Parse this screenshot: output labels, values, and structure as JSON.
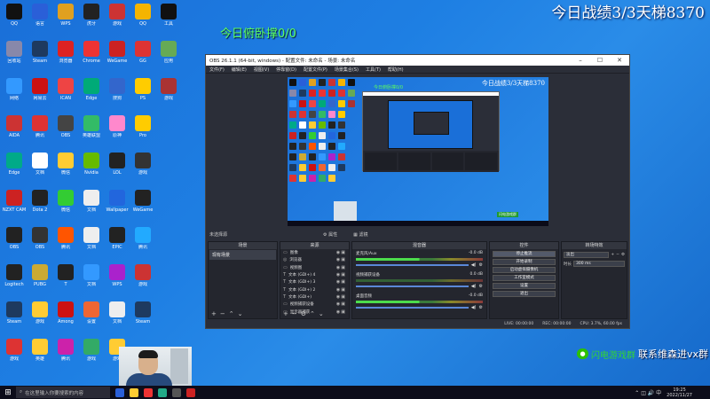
{
  "overlay": {
    "top_right": "今日战绩3/3天梯8370",
    "pushup": "今日俯卧撑0/0",
    "wechat_green": "闪电游戏群",
    "wechat_white": "联系维森进vx群"
  },
  "desktop": {
    "icons": [
      {
        "label": "QQ",
        "color": "#111"
      },
      {
        "label": "语言",
        "color": "#2a5fd8"
      },
      {
        "label": "WPS",
        "color": "#e0a020"
      },
      {
        "label": "虎牙",
        "color": "#222"
      },
      {
        "label": "游戏",
        "color": "#c33"
      },
      {
        "label": "QQ",
        "color": "#f5b400"
      },
      {
        "label": "工具",
        "color": "#111"
      },
      {
        "label": "回收站",
        "color": "#88a"
      },
      {
        "label": "Steam",
        "color": "#1e3a5f"
      },
      {
        "label": "浏览器",
        "color": "#d22"
      },
      {
        "label": "Chrome",
        "color": "#e33"
      },
      {
        "label": "WeGame",
        "color": "#c22"
      },
      {
        "label": "GG",
        "color": "#d33"
      },
      {
        "label": "应用",
        "color": "#6a5"
      },
      {
        "label": "网络",
        "color": "#39f"
      },
      {
        "label": "网易云",
        "color": "#c11"
      },
      {
        "label": "ICAN",
        "color": "#e44"
      },
      {
        "label": "Edge",
        "color": "#0a7"
      },
      {
        "label": "搜狗",
        "color": "#36c"
      },
      {
        "label": "PS",
        "color": "#fc0"
      },
      {
        "label": "游戏",
        "color": "#a33"
      },
      {
        "label": "AIDA",
        "color": "#c33"
      },
      {
        "label": "腾讯",
        "color": "#d33"
      },
      {
        "label": "OBS",
        "color": "#444"
      },
      {
        "label": "英雄联盟",
        "color": "#3b6"
      },
      {
        "label": "原神",
        "color": "#f8c"
      },
      {
        "label": "Pro",
        "color": "#fc0"
      },
      {
        "label": "",
        "color": "transparent"
      },
      {
        "label": "Edge",
        "color": "#0a8"
      },
      {
        "label": "文档",
        "color": "#fff"
      },
      {
        "label": "微信",
        "color": "#fc3"
      },
      {
        "label": "Nvidia",
        "color": "#6b0"
      },
      {
        "label": "LOL",
        "color": "#222"
      },
      {
        "label": "游戏",
        "color": "#333"
      },
      {
        "label": "",
        "color": "transparent"
      },
      {
        "label": "NZXT CAM",
        "color": "#c22"
      },
      {
        "label": "Dota 2",
        "color": "#222"
      },
      {
        "label": "微信",
        "color": "#3c3"
      },
      {
        "label": "文档",
        "color": "#eee"
      },
      {
        "label": "Wallpaper",
        "color": "#26d"
      },
      {
        "label": "WeGame",
        "color": "#222"
      },
      {
        "label": "",
        "color": "transparent"
      },
      {
        "label": "OBS",
        "color": "#222"
      },
      {
        "label": "OBS",
        "color": "#333"
      },
      {
        "label": "腾讯",
        "color": "#f50"
      },
      {
        "label": "文档",
        "color": "#eee"
      },
      {
        "label": "EPIC",
        "color": "#222"
      },
      {
        "label": "腾讯",
        "color": "#2af"
      },
      {
        "label": "",
        "color": "transparent"
      },
      {
        "label": "Logitech",
        "color": "#222"
      },
      {
        "label": "PUBG",
        "color": "#ca3"
      },
      {
        "label": "T",
        "color": "#222"
      },
      {
        "label": "文档",
        "color": "#39f"
      },
      {
        "label": "WPS",
        "color": "#a2c"
      },
      {
        "label": "游戏",
        "color": "#c33"
      },
      {
        "label": "",
        "color": "transparent"
      },
      {
        "label": "Steam",
        "color": "#1e3a5f"
      },
      {
        "label": "游戏",
        "color": "#fc3"
      },
      {
        "label": "Among",
        "color": "#c11"
      },
      {
        "label": "设置",
        "color": "#e63"
      },
      {
        "label": "文档",
        "color": "#eee"
      },
      {
        "label": "Steam",
        "color": "#1e3a5f"
      },
      {
        "label": "",
        "color": "transparent"
      },
      {
        "label": "游戏",
        "color": "#d33"
      },
      {
        "label": "英雄",
        "color": "#fc3"
      },
      {
        "label": "腾讯",
        "color": "#c2a"
      },
      {
        "label": "游戏",
        "color": "#3a6"
      },
      {
        "label": "游戏",
        "color": "#fc3"
      },
      {
        "label": "",
        "color": "transparent"
      },
      {
        "label": "",
        "color": "transparent"
      }
    ]
  },
  "obs": {
    "title": "OBS 26.1.1 (64-bit, windows) - 配置文件: 未命名 - 场景: 未命名",
    "window_controls": [
      "–",
      "☐",
      "✕"
    ],
    "menu": [
      "文件(F)",
      "编辑(E)",
      "视图(V)",
      "停靠窗(D)",
      "配置文件(P)",
      "场景集合(S)",
      "工具(T)",
      "帮助(H)"
    ],
    "preview": {
      "top_right": "今日战绩3/3天梯8370",
      "pushup": "今日俯卧撑0/0",
      "wechat": "闪电游戏群"
    },
    "no_source": "未选择源",
    "props_btn": "属性",
    "filters_btn": "滤镜",
    "docks": {
      "scenes_title": "场景",
      "scene_item": "现有场景",
      "sources_title": "来源",
      "sources": [
        {
          "name": "图像",
          "icon": "▭"
        },
        {
          "name": "浏览器",
          "icon": "◎"
        },
        {
          "name": "视频图",
          "icon": "▭"
        },
        {
          "name": "文本 (GDI+) 4",
          "icon": "T"
        },
        {
          "name": "文本 (GDI+) 3",
          "icon": "T"
        },
        {
          "name": "文本 (GDI+) 2",
          "icon": "T"
        },
        {
          "name": "文本 (GDI+)",
          "icon": "T"
        },
        {
          "name": "视频捕获设备",
          "icon": "▭"
        },
        {
          "name": "显示器捕获",
          "icon": "▭"
        }
      ],
      "mixer_title": "混音器",
      "mixer": [
        {
          "name": "麦克风/Aux",
          "db": "-0.0 dB",
          "active": true
        },
        {
          "name": "视频捕获设备",
          "db": "0.0 dB",
          "active": false
        },
        {
          "name": "桌面音频",
          "db": "-0.0 dB",
          "active": true
        }
      ],
      "controls_title": "控件",
      "controls": [
        {
          "label": "停止推流",
          "on": true
        },
        {
          "label": "开始录制",
          "on": false
        },
        {
          "label": "启动虚拟摄像机",
          "on": false
        },
        {
          "label": "工作室模式",
          "on": false
        },
        {
          "label": "设置",
          "on": false
        },
        {
          "label": "退出",
          "on": false
        }
      ],
      "transitions_title": "转场特效",
      "transition_value": "淡出",
      "duration_label": "时长",
      "duration_value": "300 ms"
    },
    "status": [
      "LIVE: 00:00:00",
      "REC: 00:00:00",
      "CPU: 3.7%, 60.00 fps"
    ]
  },
  "taskbar": {
    "start_icon": "⊞",
    "search_placeholder": "在这里输入你要搜索的内容",
    "apps": [
      "#2a5fd8",
      "#fc3",
      "#e33",
      "#2a8",
      "#555",
      "#c22"
    ],
    "time": "19:25",
    "date": "2022/11/27",
    "tray": "⌃ ◫ 🔊 中"
  }
}
